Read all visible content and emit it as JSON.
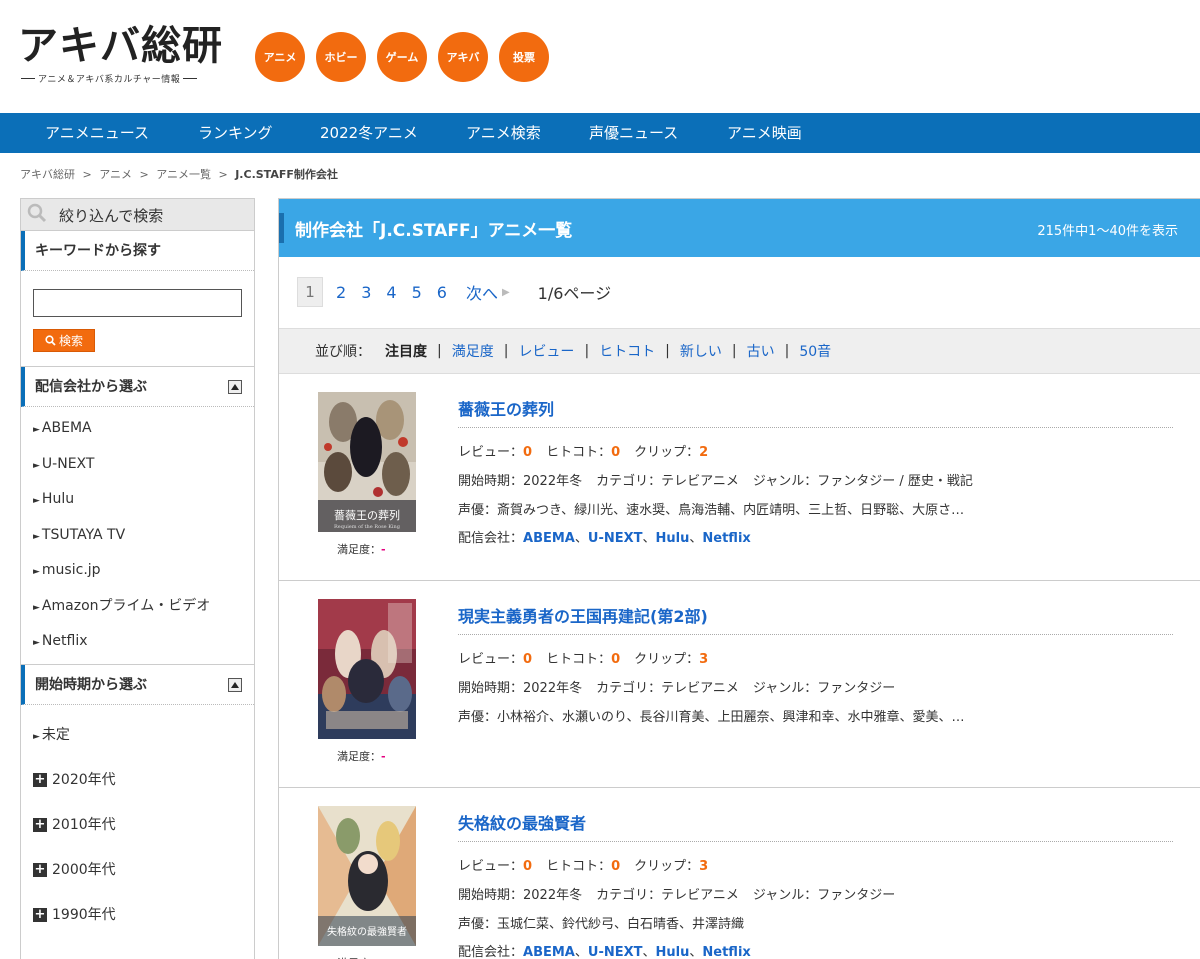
{
  "header": {
    "logo_main": "アキバ総研",
    "logo_sub": "アニメ＆アキバ系カルチャー情報",
    "categories": [
      "アニメ",
      "ホビー",
      "ゲーム",
      "アキバ",
      "投票"
    ],
    "accent_color": "#f26b0f"
  },
  "nav": {
    "items": [
      "アニメニュース",
      "ランキング",
      "2022冬アニメ",
      "アニメ検索",
      "声優ニュース",
      "アニメ映画"
    ],
    "color": "#0b6fb8"
  },
  "breadcrumb": {
    "items": [
      "アキバ総研",
      "アニメ",
      "アニメ一覧"
    ],
    "separator": ">",
    "current": "J.C.STAFF制作会社"
  },
  "sidebar": {
    "header": "絞り込んで検索",
    "keyword_title": "キーワードから探す",
    "keyword_value": "",
    "search_button": "検索",
    "distributors_title": "配信会社から選ぶ",
    "distributors": [
      "ABEMA",
      "U-NEXT",
      "Hulu",
      "TSUTAYA TV",
      "music.jp",
      "Amazonプライム・ビデオ",
      "Netflix"
    ],
    "period_title": "開始時期から選ぶ",
    "period_undecided": "未定",
    "decades": [
      "2020年代",
      "2010年代",
      "2000年代",
      "1990年代"
    ]
  },
  "main": {
    "title": "制作会社「J.C.STAFF」アニメ一覧",
    "count": "215件中1～40件を表示",
    "pager": {
      "current": "1",
      "pages": [
        "2",
        "3",
        "4",
        "5",
        "6"
      ],
      "next": "次へ",
      "status": "1/6ページ"
    },
    "sort": {
      "label": "並び順：",
      "active": "注目度",
      "options": [
        "満足度",
        "レビュー",
        "ヒトコト",
        "新しい",
        "古い",
        "50音"
      ]
    },
    "labels": {
      "satisfaction": "満足度：",
      "satisfaction_value": "-",
      "review": "レビュー：",
      "hitokoto": "ヒトコト：",
      "clip": "クリップ：",
      "start": "開始時期：",
      "category": "カテゴリ：",
      "genre": "ジャンル：",
      "cast": "声優：",
      "distributor": "配信会社：",
      "distributor_sep": "、"
    },
    "entries": [
      {
        "title": "薔薇王の葬列",
        "review": "0",
        "hitokoto": "0",
        "clip": "2",
        "start": "2022年冬",
        "category": "テレビアニメ",
        "genre": "ファンタジー / 歴史・戦記",
        "cast": "斎賀みつき、緑川光、速水奨、鳥海浩輔、内匠靖明、三上哲、日野聡、大原さ…",
        "distributors": [
          "ABEMA",
          "U-NEXT",
          "Hulu",
          "Netflix"
        ],
        "poster_text": "薔薇王の葬列",
        "poster_sub": "Requiem of the Rose King"
      },
      {
        "title": "現実主義勇者の王国再建記(第2部)",
        "review": "0",
        "hitokoto": "0",
        "clip": "3",
        "start": "2022年冬",
        "category": "テレビアニメ",
        "genre": "ファンタジー",
        "cast": "小林裕介、水瀬いのり、長谷川育美、上田麗奈、興津和幸、水中雅章、愛美、…",
        "distributors": []
      },
      {
        "title": "失格紋の最強賢者",
        "review": "0",
        "hitokoto": "0",
        "clip": "3",
        "start": "2022年冬",
        "category": "テレビアニメ",
        "genre": "ファンタジー",
        "cast": "玉城仁菜、鈴代紗弓、白石晴香、井澤詩織",
        "distributors": [
          "ABEMA",
          "U-NEXT",
          "Hulu",
          "Netflix"
        ],
        "poster_text": "失格紋の最強賢者"
      }
    ]
  }
}
